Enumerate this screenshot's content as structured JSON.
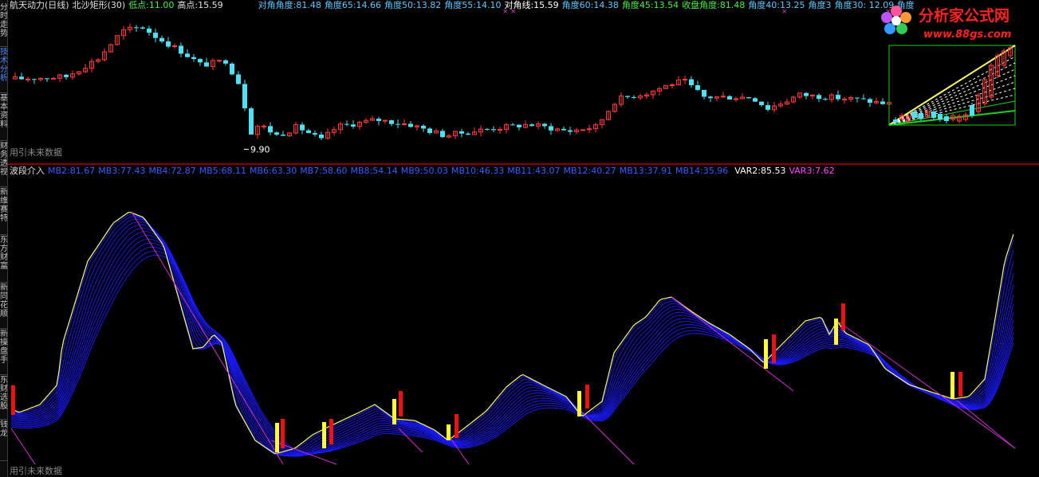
{
  "sidebar": {
    "tabs": [
      {
        "label": "分时走势",
        "active": false
      },
      {
        "label": "技术分析",
        "active": true
      },
      {
        "label": "基本资料",
        "active": false
      },
      {
        "label": "财务透视",
        "active": false
      },
      {
        "label": "新维赛特",
        "active": false
      },
      {
        "label": "东方财富",
        "active": false
      },
      {
        "label": "新同花顺",
        "active": false
      },
      {
        "label": "新操盘手",
        "active": false
      },
      {
        "label": "东财选股",
        "active": false
      },
      {
        "label": "钱龙",
        "active": false
      }
    ]
  },
  "top_header": {
    "stock_title": "航天动力(日线)",
    "indicator_title": "北沙矩形(30)",
    "low_label": "低点:",
    "low_value": "11.00",
    "high_label": "高点:",
    "high_value": "15.59",
    "angles": [
      {
        "label": "对角角度:",
        "value": "81.48",
        "color": "#5ec8ff"
      },
      {
        "label": "角度65:",
        "value": "14.66",
        "color": "#5ec8ff"
      },
      {
        "label": "角度50:",
        "value": "13.82",
        "color": "#5ec8ff"
      },
      {
        "label": "角度55:",
        "value": "14.10",
        "color": "#5ec8ff"
      },
      {
        "label": "对角线:",
        "value": "15.59",
        "color": "#ffffff"
      },
      {
        "label": "角度60:",
        "value": "14.38",
        "color": "#5ec8ff"
      },
      {
        "label": "角度45:",
        "value": "13.54",
        "color": "#44ee44"
      },
      {
        "label": "收盘角度:",
        "value": "81.48",
        "color": "#44ee44"
      },
      {
        "label": "角度40:",
        "value": "13.25",
        "color": "#5ec8ff"
      },
      {
        "label": "角度3",
        "value": "",
        "color": "#5ec8ff"
      }
    ],
    "hidden_tail": "角度30: 12.09 角度"
  },
  "top_chart": {
    "low_marker": "9.90",
    "watermark": "用引未来数据"
  },
  "bottom_header": {
    "title": "波段介入",
    "mb": [
      {
        "label": "MB2:",
        "value": "81.67"
      },
      {
        "label": "MB3:",
        "value": "77.43"
      },
      {
        "label": "MB4:",
        "value": "72.87"
      },
      {
        "label": "MB5:",
        "value": "68.11"
      },
      {
        "label": "MB6:",
        "value": "63.30"
      },
      {
        "label": "MB7:",
        "value": "58.60"
      },
      {
        "label": "MB8:",
        "value": "54.14"
      },
      {
        "label": "MB9:",
        "value": "50.03"
      },
      {
        "label": "MB10:",
        "value": "46.33"
      },
      {
        "label": "MB11:",
        "value": "43.07"
      },
      {
        "label": "MB12:",
        "value": "40.27"
      },
      {
        "label": "MB13:",
        "value": "37.91"
      },
      {
        "label": "MB14:",
        "value": "35.96"
      }
    ],
    "var2_label": "VAR2:",
    "var2_value": "85.53",
    "var3_label": "VAR3:",
    "var3_value": "7.62"
  },
  "bottom_chart": {
    "watermark": "用引未来数据"
  },
  "logo": {
    "text": "分析家公式网",
    "url": "www.88gs.com"
  },
  "colors": {
    "up": "#ff3b3b",
    "down": "#50e0f0",
    "ribbon": "#1a1aff",
    "ma_yellow": "#ffff66",
    "magenta": "#d030d0",
    "bar_yellow": "#ffff33",
    "bar_red": "#ee1111",
    "mb_text": "#3a5cff"
  }
}
